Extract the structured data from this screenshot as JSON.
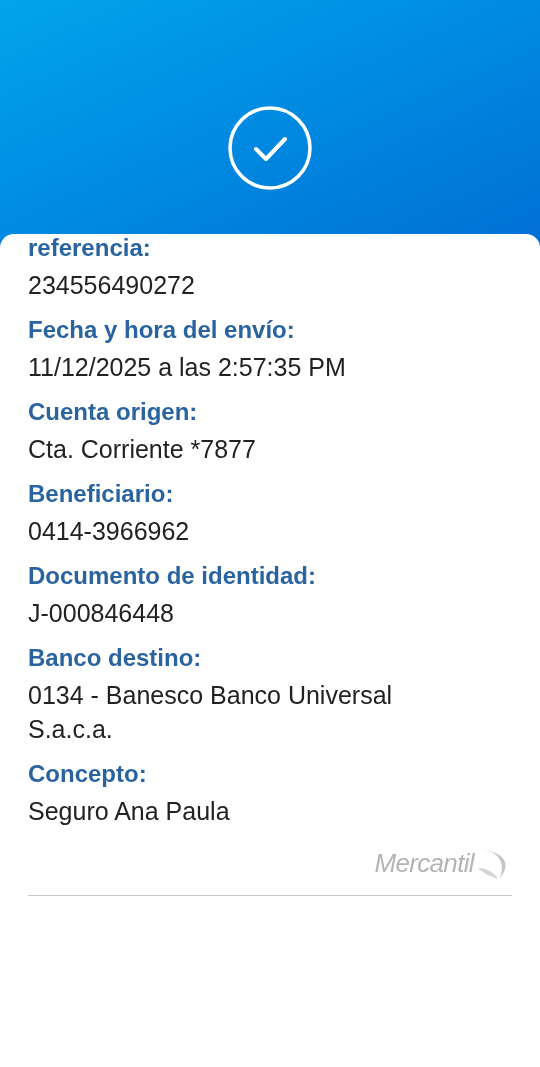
{
  "fields": [
    {
      "label": "referencia:",
      "value": "234556490272"
    },
    {
      "label": "Fecha y hora del envío:",
      "value": "11/12/2025 a las 2:57:35 PM"
    },
    {
      "label": "Cuenta origen:",
      "value": "Cta. Corriente *7877"
    },
    {
      "label": "Beneficiario:",
      "value": "0414-3966962"
    },
    {
      "label": "Documento de identidad:",
      "value": "J-000846448"
    },
    {
      "label": "Banco destino:",
      "value": "0134 - Banesco Banco Universal S.a.c.a."
    },
    {
      "label": "Concepto:",
      "value": "Seguro Ana Paula"
    }
  ],
  "logo": {
    "text": "Mercantil"
  }
}
